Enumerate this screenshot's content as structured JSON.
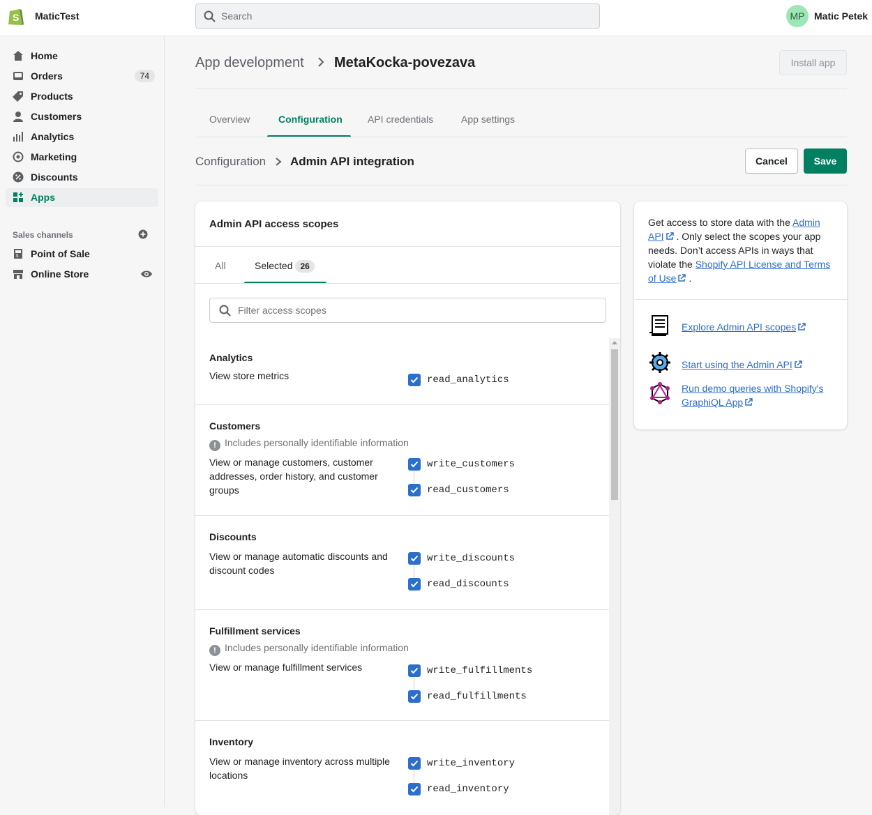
{
  "topbar": {
    "store_name": "MaticTest",
    "search_placeholder": "Search",
    "avatar_initials": "MP",
    "user_name": "Matic Petek"
  },
  "sidebar": {
    "items": [
      {
        "label": "Home",
        "icon": "home-icon"
      },
      {
        "label": "Orders",
        "icon": "orders-icon",
        "badge": "74"
      },
      {
        "label": "Products",
        "icon": "tag-icon"
      },
      {
        "label": "Customers",
        "icon": "person-icon"
      },
      {
        "label": "Analytics",
        "icon": "bar-chart-icon"
      },
      {
        "label": "Marketing",
        "icon": "target-icon"
      },
      {
        "label": "Discounts",
        "icon": "discount-icon"
      },
      {
        "label": "Apps",
        "icon": "apps-icon",
        "active": true
      }
    ],
    "sales_channels_title": "Sales channels",
    "channels": [
      {
        "label": "Point of Sale",
        "icon": "store-icon"
      },
      {
        "label": "Online Store",
        "icon": "online-store-icon"
      }
    ]
  },
  "header": {
    "breadcrumb_parent": "App development",
    "title": "MetaKocka-povezava",
    "install_button": "Install app"
  },
  "tabs": [
    "Overview",
    "Configuration",
    "API credentials",
    "App settings"
  ],
  "active_tab": "Configuration",
  "config_header": {
    "parent": "Configuration",
    "title": "Admin API integration",
    "cancel_label": "Cancel",
    "save_label": "Save"
  },
  "scopes_card": {
    "title": "Admin API access scopes",
    "tab_all": "All",
    "tab_selected": "Selected",
    "selected_count": "26",
    "filter_placeholder": "Filter access scopes",
    "pii_text": "Includes personally identifiable information",
    "groups": [
      {
        "title": "Analytics",
        "description": "View store metrics",
        "scopes": [
          "read_analytics"
        ]
      },
      {
        "title": "Customers",
        "pii": true,
        "description": "View or manage customers, customer addresses, order history, and customer groups",
        "scopes": [
          "write_customers",
          "read_customers"
        ]
      },
      {
        "title": "Discounts",
        "description": "View or manage automatic discounts and discount codes",
        "scopes": [
          "write_discounts",
          "read_discounts"
        ]
      },
      {
        "title": "Fulfillment services",
        "pii": true,
        "description": "View or manage fulfillment services",
        "scopes": [
          "write_fulfillments",
          "read_fulfillments"
        ]
      },
      {
        "title": "Inventory",
        "description": "View or manage inventory across multiple locations",
        "scopes": [
          "write_inventory",
          "read_inventory"
        ]
      }
    ]
  },
  "side_card": {
    "text_1": "Get access to store data with the ",
    "link_admin_api": "Admin API",
    "text_2": " . Only select the scopes your app needs. Don’t access APIs in ways that violate the ",
    "link_license": "Shopify API License and Terms of Use",
    "text_3": " .",
    "resources": [
      {
        "label": "Explore Admin API scopes",
        "icon": "scroll-icon"
      },
      {
        "label": "Start using the Admin API",
        "icon": "gear-icon"
      },
      {
        "label": "Run demo queries with Shopify's GraphiQL App",
        "icon": "graphql-icon"
      }
    ]
  },
  "colors": {
    "accent": "#008060",
    "checkbox": "#2c6ecb",
    "link": "#2c6ecb"
  }
}
